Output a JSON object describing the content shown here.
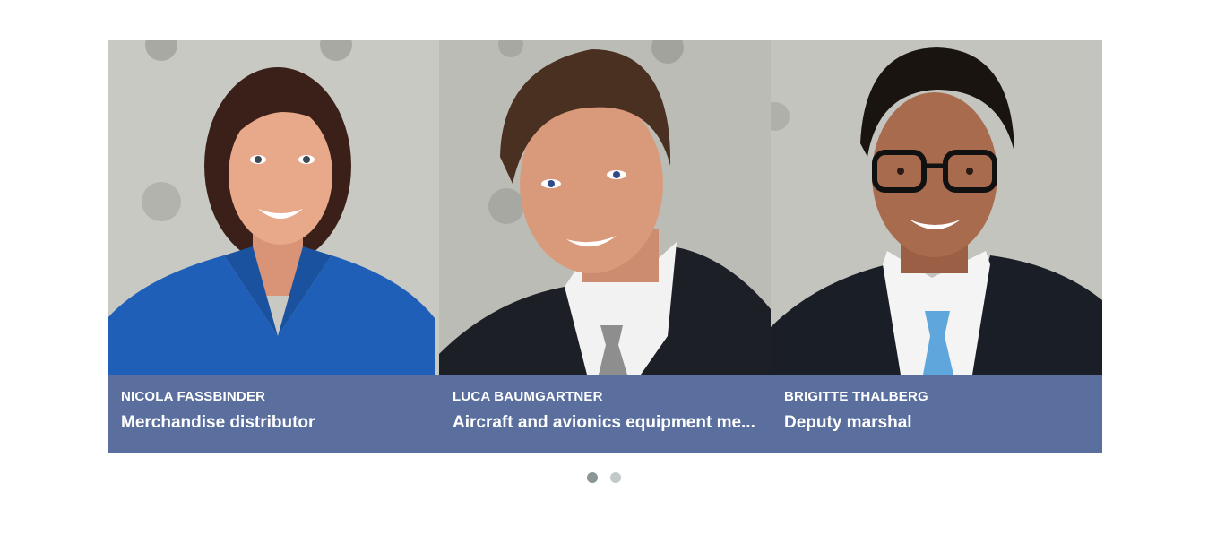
{
  "carousel": {
    "cards": [
      {
        "name": "NICOLA FASSBINDER",
        "role": "Merchandise distributor",
        "photo": {
          "subject": "woman-portrait",
          "background": "#c9c9c4",
          "skin": "#e8a88a",
          "hair": "#3a2018",
          "clothing": "#1f5fb8",
          "accessory": "none"
        }
      },
      {
        "name": "LUCA BAUMGARTNER",
        "role": "Aircraft and avionics equipment me...",
        "photo": {
          "subject": "man-portrait",
          "background": "#bcbcb6",
          "skin": "#d99a7c",
          "hair": "#4a3020",
          "clothing": "#1c1f26",
          "shirt": "#f2f2f2",
          "tie": "#8e8e8e",
          "accessory": "none"
        }
      },
      {
        "name": "BRIGITTE THALBERG",
        "role": "Deputy marshal",
        "photo": {
          "subject": "man-portrait-glasses",
          "background": "#c4c4be",
          "skin": "#a86b4e",
          "hair": "#1a1410",
          "clothing": "#1a1e26",
          "shirt": "#f4f4f4",
          "tie": "#5ea6dc",
          "accessory": "glasses"
        }
      }
    ],
    "caption_color": "#5a6f9e",
    "pagination": {
      "count": 2,
      "active_index": 0,
      "active_color": "#8a9695",
      "inactive_color": "#c2c9c9"
    }
  }
}
